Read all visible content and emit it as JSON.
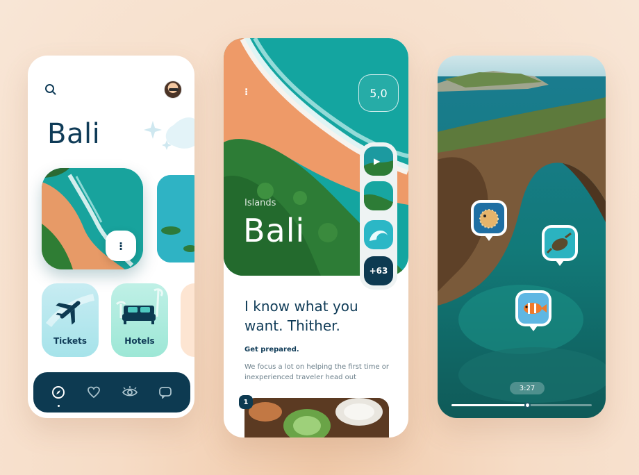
{
  "screen1": {
    "title": "Bali",
    "categories": [
      {
        "label": "Tickets",
        "icon": "airplane-icon"
      },
      {
        "label": "Hotels",
        "icon": "bed-icon"
      }
    ],
    "nav": [
      {
        "icon": "compass-icon",
        "active": true
      },
      {
        "icon": "heart-icon",
        "active": false
      },
      {
        "icon": "eye-icon",
        "active": false
      },
      {
        "icon": "chat-icon",
        "active": false
      }
    ]
  },
  "screen2": {
    "rating": "5,0",
    "subtitle": "Islands",
    "title": "Bali",
    "more_count": "+63",
    "headline_line1": "I know what you",
    "headline_line2": "want. Thither.",
    "section_label": "Get prepared.",
    "description": "We focus a lot on helping the first time or inexperienced traveler head out",
    "item_number": "1"
  },
  "screen3": {
    "time": "3:27",
    "progress": 0.54,
    "pins": [
      "pufferfish",
      "sea-turtle",
      "clownfish"
    ]
  },
  "colors": {
    "navy": "#0d3a51",
    "teal": "#14a5a5",
    "sand": "#f0a070",
    "background": "#f6dcc6"
  }
}
